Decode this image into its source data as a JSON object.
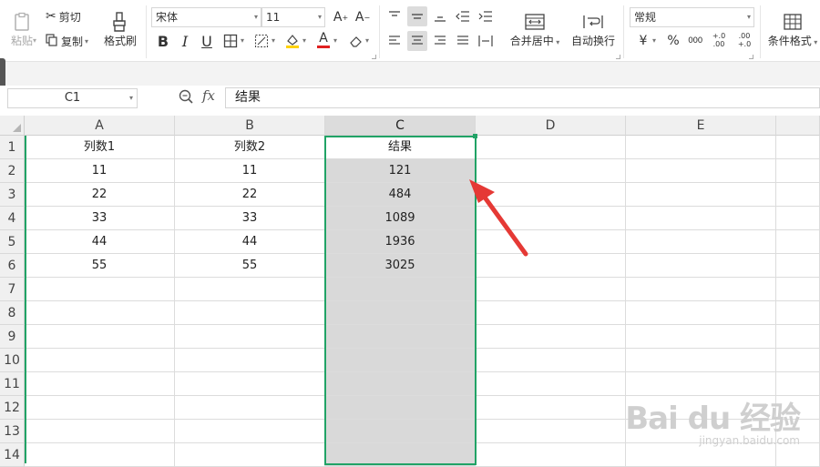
{
  "ribbon": {
    "paste_label": "粘贴",
    "cut_label": "剪切",
    "copy_label": "复制",
    "format_painter_label": "格式刷",
    "font_name": "宋体",
    "font_size": "11",
    "bold": "B",
    "italic": "I",
    "underline": "U",
    "font_color_glyph": "A",
    "merge_center_label": "合并居中",
    "wrap_text_label": "自动换行",
    "number_format": "常规",
    "currency_glyph": "¥",
    "percent_glyph": "%",
    "thousands_glyph": "000",
    "increase_decimal_glyph": "+.0 .00",
    "decrease_decimal_glyph": ".00 +.0",
    "conditional_format_label": "条件格式"
  },
  "formula_bar": {
    "cell_ref": "C1",
    "fx": "fx",
    "content": "结果"
  },
  "sheet": {
    "columns": [
      "A",
      "B",
      "C",
      "D",
      "E"
    ],
    "rows": [
      "1",
      "2",
      "3",
      "4",
      "5",
      "6",
      "7",
      "8",
      "9",
      "10",
      "11",
      "12",
      "13",
      "14"
    ],
    "cells": [
      [
        "列数1",
        "列数2",
        "结果",
        "",
        ""
      ],
      [
        "11",
        "11",
        "121",
        "",
        ""
      ],
      [
        "22",
        "22",
        "484",
        "",
        ""
      ],
      [
        "33",
        "33",
        "1089",
        "",
        ""
      ],
      [
        "44",
        "44",
        "1936",
        "",
        ""
      ],
      [
        "55",
        "55",
        "3025",
        "",
        ""
      ]
    ],
    "selected_column": "C",
    "selection_color": "#21a366",
    "annotation_arrow_color": "#e53935"
  },
  "watermark": {
    "brand": "Bai du 经验",
    "url": "jingyan.baidu.com"
  }
}
